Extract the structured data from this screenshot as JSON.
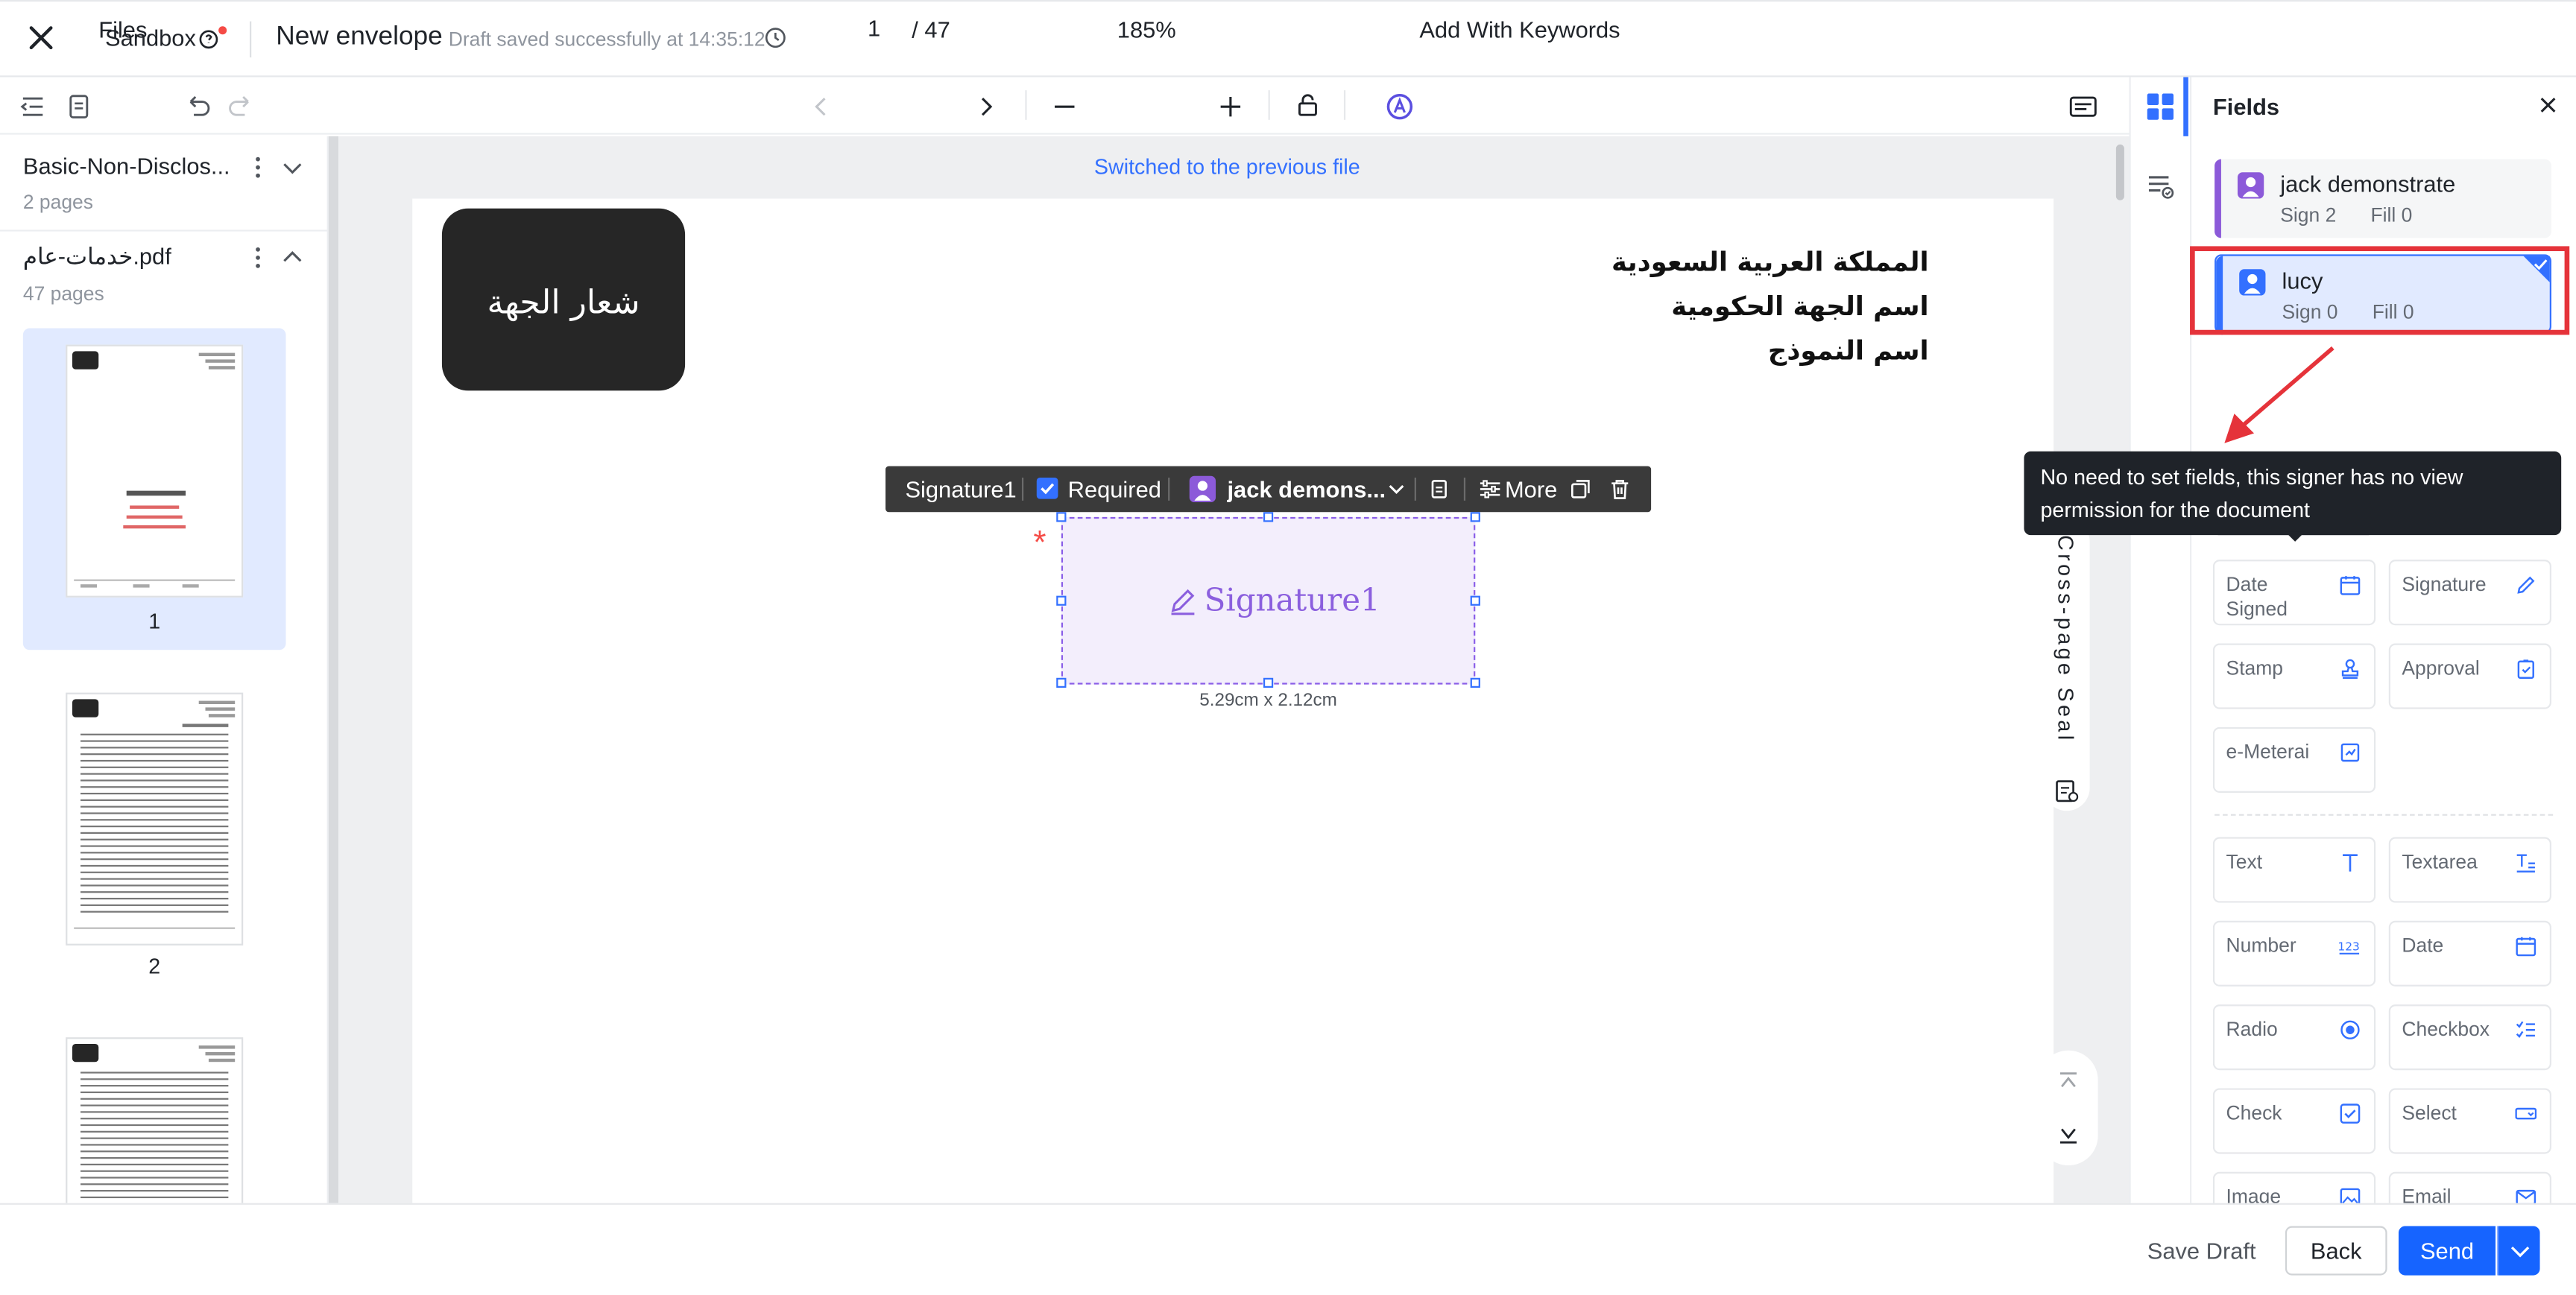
{
  "topbar": {
    "sandbox_label": "Sandbox",
    "envelope_title": "New envelope",
    "draft_status": "Draft saved successfully at 14:35:12"
  },
  "toolbar": {
    "files_label": "Files",
    "current_page": "1",
    "total_pages": "/ 47",
    "zoom": "185%",
    "add_keywords_label": "Add With Keywords"
  },
  "files": [
    {
      "name": "Basic-Non-Disclos...",
      "pages": "2 pages",
      "expanded": false
    },
    {
      "name": "خدمات-عام.pdf",
      "pages": "47 pages",
      "expanded": true
    }
  ],
  "thumbnails": [
    {
      "number": "1",
      "selected": true
    },
    {
      "number": "2",
      "selected": false
    },
    {
      "number": "",
      "selected": false
    }
  ],
  "canvas": {
    "switched_message": "Switched to the previous file",
    "logo_text": "شعار الجهة",
    "header_lines": [
      "المملكة العربية السعودية",
      "اسم الجهة الحكومية",
      "اسم النموذج"
    ]
  },
  "field_toolbar": {
    "field_name": "Signature1",
    "required_label": "Required",
    "required_checked": true,
    "signer": "jack demons...",
    "more_label": "More"
  },
  "signature_field": {
    "label": "Signature1",
    "size": "5.29cm x 2.12cm"
  },
  "cross_page_seal_label": "Cross-page Seal",
  "tooltip": "No need to set fields, this signer has no view permission for the document",
  "fields_panel": {
    "title": "Fields",
    "signers": [
      {
        "name": "jack demonstrate",
        "sign": "Sign  2",
        "fill": "Fill  0",
        "color": "#8c5ad9",
        "selected": false
      },
      {
        "name": "lucy",
        "sign": "Sign  0",
        "fill": "Fill  0",
        "color": "#3370ff",
        "selected": true
      }
    ],
    "signature_fields": [
      {
        "label": "Date Signed",
        "icon": "calendar-icon"
      },
      {
        "label": "Signature",
        "icon": "pen-icon"
      },
      {
        "label": "Stamp",
        "icon": "stamp-icon"
      },
      {
        "label": "Approval",
        "icon": "clipboard-check-icon"
      },
      {
        "label": "e-Meterai",
        "icon": "meterai-icon"
      }
    ],
    "fill_fields": [
      {
        "label": "Text",
        "icon": "text-icon"
      },
      {
        "label": "Textarea",
        "icon": "textarea-icon"
      },
      {
        "label": "Number",
        "icon": "number-icon"
      },
      {
        "label": "Date",
        "icon": "calendar-icon"
      },
      {
        "label": "Radio",
        "icon": "radio-icon"
      },
      {
        "label": "Checkbox",
        "icon": "checklist-icon"
      },
      {
        "label": "Check",
        "icon": "check-square-icon"
      },
      {
        "label": "Select",
        "icon": "select-icon"
      },
      {
        "label": "Image",
        "icon": "image-icon"
      },
      {
        "label": "Email",
        "icon": "email-icon"
      }
    ]
  },
  "footer": {
    "save_draft_label": "Save Draft",
    "back_label": "Back",
    "send_label": "Send"
  },
  "colors": {
    "primary": "#1664ff",
    "signer_jack": "#8c5ad9",
    "signer_lucy": "#3370ff",
    "highlight_red": "#e5333a"
  }
}
